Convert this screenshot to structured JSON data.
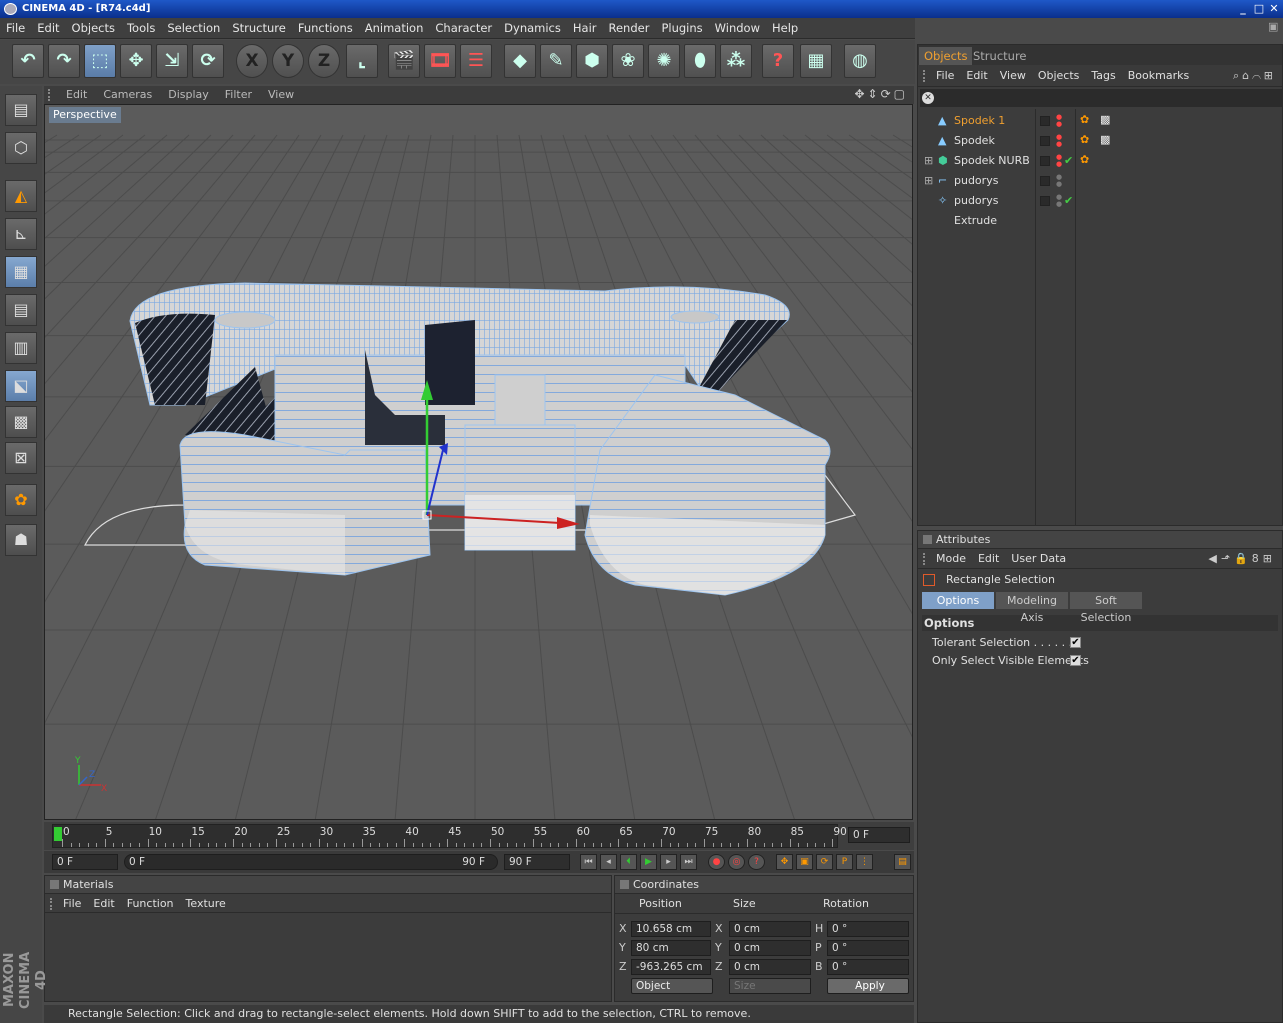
{
  "window": {
    "title": "CINEMA 4D - [R74.c4d]"
  },
  "menu": [
    "File",
    "Edit",
    "Objects",
    "Tools",
    "Selection",
    "Structure",
    "Functions",
    "Animation",
    "Character",
    "Dynamics",
    "Hair",
    "Render",
    "Plugins",
    "Window",
    "Help"
  ],
  "toolbar_icons": [
    "undo-icon",
    "redo-icon",
    "rectangle-select-icon",
    "move-icon",
    "scale-icon",
    "rotate-icon",
    "x-axis-lock-icon",
    "y-axis-lock-icon",
    "z-axis-lock-icon",
    "world-coordinates-icon",
    "render-view-icon",
    "render-picture-icon",
    "render-settings-icon",
    "cube-icon",
    "spline-pen-icon",
    "nurbs-icon",
    "array-icon",
    "deformer-icon",
    "environment-icon",
    "particles-icon",
    "help-icon",
    "layout-icon",
    "web-icon"
  ],
  "toolbar_labels": {
    "x": "X",
    "y": "Y",
    "z": "Z"
  },
  "left_icons": [
    "viewport-mode-icon",
    "model-mode-icon",
    "points-mode-icon",
    "edges-mode-icon",
    "polygons-mode-icon",
    "texture-mode-icon",
    "object-axis-icon",
    "animation-mode-icon",
    "uv-points-icon",
    "uv-polygons-icon",
    "paint-icon",
    "sculpt-icon"
  ],
  "viewport": {
    "menu": [
      "Edit",
      "Cameras",
      "Display",
      "Filter",
      "View"
    ],
    "label": "Perspective",
    "axis": {
      "y": "Y",
      "x": "X",
      "z": "Z"
    }
  },
  "timeline": {
    "ticks": [
      "0",
      "5",
      "10",
      "15",
      "20",
      "25",
      "30",
      "35",
      "40",
      "45",
      "50",
      "55",
      "60",
      "65",
      "70",
      "75",
      "80",
      "85",
      "90"
    ],
    "current": "0 F"
  },
  "transport": {
    "start": "0 F",
    "range_start": "0 F",
    "range_end": "90 F",
    "end": "90 F"
  },
  "materials": {
    "title": "Materials",
    "menu": [
      "File",
      "Edit",
      "Function",
      "Texture"
    ]
  },
  "coordinates": {
    "title": "Coordinates",
    "headers": [
      "Position",
      "Size",
      "Rotation"
    ],
    "rows": [
      {
        "axis": "X",
        "pos": "10.658 cm",
        "size_axis": "X",
        "size": "0 cm",
        "rot_axis": "H",
        "rot": "0 °"
      },
      {
        "axis": "Y",
        "pos": "80 cm",
        "size_axis": "Y",
        "size": "0 cm",
        "rot_axis": "P",
        "rot": "0 °"
      },
      {
        "axis": "Z",
        "pos": "-963.265 cm",
        "size_axis": "Z",
        "size": "0 cm",
        "rot_axis": "B",
        "rot": "0 °"
      }
    ],
    "mode": "Object",
    "size_mode": "Size",
    "apply": "Apply"
  },
  "status": "Rectangle Selection: Click and drag to rectangle-select elements. Hold down SHIFT to add to the selection, CTRL to remove.",
  "logo": "MAXON CINEMA 4D",
  "objects": {
    "tabs": [
      "Objects",
      "Structure"
    ],
    "menu": [
      "File",
      "Edit",
      "View",
      "Objects",
      "Tags",
      "Bookmarks"
    ],
    "items": [
      {
        "name": "Spodek 1",
        "selected": true
      },
      {
        "name": "Spodek"
      },
      {
        "name": "Spodek NURB"
      },
      {
        "name": "pudorys"
      },
      {
        "name": "pudorys Extrude"
      }
    ]
  },
  "attributes": {
    "title": "Attributes",
    "menu": [
      "Mode",
      "Edit",
      "User Data"
    ],
    "tool": "Rectangle Selection",
    "tabs": [
      "Options",
      "Modeling Axis",
      "Soft Selection"
    ],
    "section": "Options",
    "options": [
      {
        "label": "Tolerant Selection . . . . . . .",
        "checked": true
      },
      {
        "label": "Only Select Visible Elements",
        "checked": true
      }
    ]
  },
  "colors": {
    "accent": "#f0a030",
    "selection": "#7fa0c8"
  }
}
